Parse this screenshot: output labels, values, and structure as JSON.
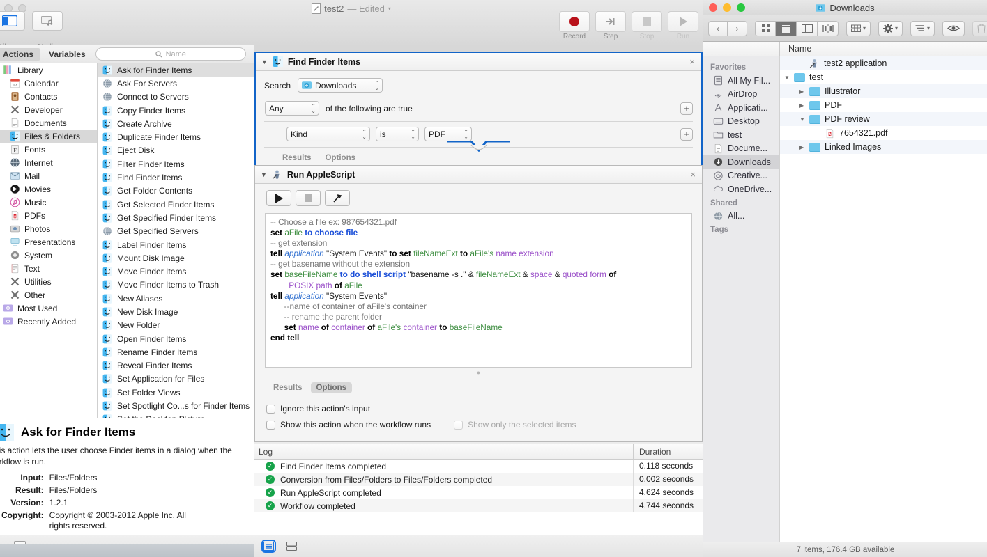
{
  "automator": {
    "document_title": "test2",
    "document_state": "— Edited",
    "toolbar_left": [
      {
        "label": "Library",
        "icon": "library-icon"
      },
      {
        "label": "Media",
        "icon": "media-icon"
      }
    ],
    "toolbar_right": [
      {
        "label": "Record",
        "icon": "record-icon"
      },
      {
        "label": "Step",
        "icon": "step-icon"
      },
      {
        "label": "Stop",
        "icon": "stop-icon"
      },
      {
        "label": "Run",
        "icon": "run-icon"
      }
    ],
    "library_bar": {
      "tab_actions": "Actions",
      "tab_variables": "Variables",
      "search_placeholder": "Name",
      "search_value": "",
      "search_icon": "search-icon"
    },
    "library_items": [
      {
        "label": "Library",
        "icon": "library-color-icon",
        "selected": false
      },
      {
        "label": "Calendar",
        "icon": "calendar-icon",
        "selected": false
      },
      {
        "label": "Contacts",
        "icon": "contacts-icon",
        "selected": false
      },
      {
        "label": "Developer",
        "icon": "developer-icon",
        "selected": false
      },
      {
        "label": "Documents",
        "icon": "documents-icon",
        "selected": false
      },
      {
        "label": "Files & Folders",
        "icon": "finder-icon",
        "selected": true
      },
      {
        "label": "Fonts",
        "icon": "fonts-icon",
        "selected": false
      },
      {
        "label": "Internet",
        "icon": "internet-icon",
        "selected": false
      },
      {
        "label": "Mail",
        "icon": "mail-icon",
        "selected": false
      },
      {
        "label": "Movies",
        "icon": "movies-icon",
        "selected": false
      },
      {
        "label": "Music",
        "icon": "music-icon",
        "selected": false
      },
      {
        "label": "PDFs",
        "icon": "pdf-icon",
        "selected": false
      },
      {
        "label": "Photos",
        "icon": "photos-icon",
        "selected": false
      },
      {
        "label": "Presentations",
        "icon": "presentations-icon",
        "selected": false
      },
      {
        "label": "System",
        "icon": "system-icon",
        "selected": false
      },
      {
        "label": "Text",
        "icon": "text-icon",
        "selected": false
      },
      {
        "label": "Utilities",
        "icon": "utilities-icon",
        "selected": false
      },
      {
        "label": "Other",
        "icon": "other-icon",
        "selected": false
      },
      {
        "label": "Most Used",
        "icon": "smart-group-icon",
        "selected": false
      },
      {
        "label": "Recently Added",
        "icon": "smart-group-icon",
        "selected": false
      }
    ],
    "actions": [
      {
        "label": "Ask for Finder Items",
        "icon": "finder-icon",
        "selected": true
      },
      {
        "label": "Ask For Servers",
        "icon": "globe-icon",
        "selected": false
      },
      {
        "label": "Connect to Servers",
        "icon": "globe-icon",
        "selected": false
      },
      {
        "label": "Copy Finder Items",
        "icon": "finder-icon",
        "selected": false
      },
      {
        "label": "Create Archive",
        "icon": "finder-icon",
        "selected": false
      },
      {
        "label": "Duplicate Finder Items",
        "icon": "finder-icon",
        "selected": false
      },
      {
        "label": "Eject Disk",
        "icon": "finder-icon",
        "selected": false
      },
      {
        "label": "Filter Finder Items",
        "icon": "finder-icon",
        "selected": false
      },
      {
        "label": "Find Finder Items",
        "icon": "finder-icon",
        "selected": false
      },
      {
        "label": "Get Folder Contents",
        "icon": "finder-icon",
        "selected": false
      },
      {
        "label": "Get Selected Finder Items",
        "icon": "finder-icon",
        "selected": false
      },
      {
        "label": "Get Specified Finder Items",
        "icon": "finder-icon",
        "selected": false
      },
      {
        "label": "Get Specified Servers",
        "icon": "globe-icon",
        "selected": false
      },
      {
        "label": "Label Finder Items",
        "icon": "finder-icon",
        "selected": false
      },
      {
        "label": "Mount Disk Image",
        "icon": "finder-icon",
        "selected": false
      },
      {
        "label": "Move Finder Items",
        "icon": "finder-icon",
        "selected": false
      },
      {
        "label": "Move Finder Items to Trash",
        "icon": "finder-icon",
        "selected": false
      },
      {
        "label": "New Aliases",
        "icon": "finder-icon",
        "selected": false
      },
      {
        "label": "New Disk Image",
        "icon": "finder-icon",
        "selected": false
      },
      {
        "label": "New Folder",
        "icon": "finder-icon",
        "selected": false
      },
      {
        "label": "Open Finder Items",
        "icon": "finder-icon",
        "selected": false
      },
      {
        "label": "Rename Finder Items",
        "icon": "finder-icon",
        "selected": false
      },
      {
        "label": "Reveal Finder Items",
        "icon": "finder-icon",
        "selected": false
      },
      {
        "label": "Set Application for Files",
        "icon": "finder-icon",
        "selected": false
      },
      {
        "label": "Set Folder Views",
        "icon": "finder-icon",
        "selected": false
      },
      {
        "label": "Set Spotlight Co...s for Finder Items",
        "icon": "finder-icon",
        "selected": false
      },
      {
        "label": "Set the Desktop Picture",
        "icon": "finder-icon",
        "selected": false
      }
    ],
    "description": {
      "title": "Ask for Finder Items",
      "icon": "finder-icon",
      "body": "his action lets the user choose Finder items in a dialog when the orkflow is run.",
      "fields": [
        {
          "label": "Input:",
          "value": "Files/Folders"
        },
        {
          "label": "Result:",
          "value": "Files/Folders"
        },
        {
          "label": "Version:",
          "value": "1.2.1"
        },
        {
          "label": "Copyright:",
          "value": "Copyright © 2003-2012 Apple Inc.  All rights reserved."
        }
      ]
    },
    "action_find": {
      "title": "Find Finder Items",
      "icon": "finder-icon",
      "close_icon": "close-icon",
      "disclosure_icon": "triangle-down-icon",
      "search_label": "Search",
      "search_value": "Downloads",
      "search_icon": "downloads-folder-icon",
      "match_value": "Any",
      "match_suffix": "of the following are true",
      "add_icon": "plus-icon",
      "criterion": {
        "attribute": "Kind",
        "operator": "is",
        "value": "PDF"
      },
      "tabs": [
        {
          "label": "Results",
          "selected": false
        },
        {
          "label": "Options",
          "selected": false
        }
      ]
    },
    "action_script": {
      "title": "Run AppleScript",
      "icon": "applescript-icon",
      "close_icon": "close-icon",
      "disclosure_icon": "triangle-down-icon",
      "buttons": [
        {
          "name": "run-script-button",
          "icon": "play-icon"
        },
        {
          "name": "stop-script-button",
          "icon": "stop-icon"
        },
        {
          "name": "compile-script-button",
          "icon": "hammer-icon"
        }
      ],
      "code_lines": [
        [
          {
            "t": "-- Choose a file ex: 987654321.pdf",
            "c": "cm"
          }
        ],
        [
          {
            "t": "set ",
            "c": "k"
          },
          {
            "t": "aFile ",
            "c": "va"
          },
          {
            "t": "to choose file",
            "c": "kb"
          }
        ],
        [
          {
            "t": "-- get extension",
            "c": "cm"
          }
        ],
        [
          {
            "t": "tell ",
            "c": "k"
          },
          {
            "t": "application ",
            "c": "ap"
          },
          {
            "t": "\"System Events\" ",
            "c": "st"
          },
          {
            "t": "to set ",
            "c": "k"
          },
          {
            "t": "fileNameExt ",
            "c": "va"
          },
          {
            "t": "to ",
            "c": "k"
          },
          {
            "t": "aFile's ",
            "c": "va"
          },
          {
            "t": "name extension",
            "c": "pr"
          }
        ],
        [
          {
            "t": "-- get basename without the extension",
            "c": "cm"
          }
        ],
        [
          {
            "t": "set ",
            "c": "k"
          },
          {
            "t": "baseFileName ",
            "c": "va"
          },
          {
            "t": "to do shell script ",
            "c": "kb"
          },
          {
            "t": "\"basename -s .\" ",
            "c": "st"
          },
          {
            "t": "& ",
            "c": "st"
          },
          {
            "t": "fileNameExt ",
            "c": "va"
          },
          {
            "t": "& ",
            "c": "st"
          },
          {
            "t": "space ",
            "c": "pr"
          },
          {
            "t": "& ",
            "c": "st"
          },
          {
            "t": "quoted form ",
            "c": "pr"
          },
          {
            "t": "of",
            "c": "k"
          }
        ],
        [
          {
            "t": "        POSIX path ",
            "c": "pr"
          },
          {
            "t": "of ",
            "c": "k"
          },
          {
            "t": "aFile",
            "c": "va"
          }
        ],
        [
          {
            "t": "tell ",
            "c": "k"
          },
          {
            "t": "application ",
            "c": "ap"
          },
          {
            "t": "\"System Events\"",
            "c": "st"
          }
        ],
        [
          {
            "t": "      --name of container of aFile's container",
            "c": "cm"
          }
        ],
        [
          {
            "t": "      -- rename the parent folder",
            "c": "cm"
          }
        ],
        [
          {
            "t": "      ",
            "c": "st"
          },
          {
            "t": "set ",
            "c": "k"
          },
          {
            "t": "name ",
            "c": "pr"
          },
          {
            "t": "of ",
            "c": "k"
          },
          {
            "t": "container ",
            "c": "pr"
          },
          {
            "t": "of ",
            "c": "k"
          },
          {
            "t": "aFile's ",
            "c": "va"
          },
          {
            "t": "container ",
            "c": "pr"
          },
          {
            "t": "to ",
            "c": "k"
          },
          {
            "t": "baseFileName",
            "c": "va"
          }
        ],
        [
          {
            "t": "end tell",
            "c": "k"
          }
        ]
      ],
      "tabs": [
        {
          "label": "Results",
          "selected": false
        },
        {
          "label": "Options",
          "selected": true
        }
      ],
      "options": [
        {
          "label": "Ignore this action's input",
          "checked": false,
          "dim": false
        },
        {
          "label": "Show this action when the workflow runs",
          "checked": false,
          "dim": false
        },
        {
          "label": "Show only the selected items",
          "checked": false,
          "dim": true
        }
      ]
    },
    "log": {
      "columns": [
        "Log",
        "Duration"
      ],
      "rows": [
        {
          "status": "ok",
          "message": "Find Finder Items completed",
          "duration": "0.118 seconds"
        },
        {
          "status": "ok",
          "message": "Conversion from Files/Folders to Files/Folders completed",
          "duration": "0.002 seconds"
        },
        {
          "status": "ok",
          "message": "Run AppleScript completed",
          "duration": "4.624 seconds"
        },
        {
          "status": "ok",
          "message": "Workflow completed",
          "duration": "4.744 seconds"
        }
      ],
      "view_buttons": [
        {
          "name": "log-list-view-button",
          "icon": "list-view-icon",
          "selected": true
        },
        {
          "name": "log-split-view-button",
          "icon": "split-view-icon",
          "selected": false
        }
      ]
    }
  },
  "finder": {
    "window_title": "Downloads",
    "title_icon": "downloads-folder-icon",
    "traffic_colors": [
      "#ff5f57",
      "#febc2e",
      "#28c840"
    ],
    "toolbar": {
      "back_icon": "chevron-left-icon",
      "forward_icon": "chevron-right-icon",
      "view_modes": [
        {
          "name": "icon-view-button",
          "icon": "grid-view-icon",
          "selected": false
        },
        {
          "name": "list-view-button",
          "icon": "list-view-icon",
          "selected": true
        },
        {
          "name": "column-view-button",
          "icon": "column-view-icon",
          "selected": false
        },
        {
          "name": "coverflow-view-button",
          "icon": "coverflow-view-icon",
          "selected": false
        }
      ],
      "arrange_icon": "arrange-icon",
      "action_icon": "gear-icon",
      "share_icon": "share-list-icon",
      "quicklook_icon": "eye-icon",
      "delete_icon": "trash-icon"
    },
    "column_header": "Name",
    "sidebar": [
      {
        "group": "Favorites",
        "items": [
          {
            "label": "All My Fil...",
            "icon": "all-my-files-icon",
            "selected": false
          },
          {
            "label": "AirDrop",
            "icon": "airdrop-icon",
            "selected": false
          },
          {
            "label": "Applicati...",
            "icon": "applications-icon",
            "selected": false
          },
          {
            "label": "Desktop",
            "icon": "desktop-icon",
            "selected": false
          },
          {
            "label": "test",
            "icon": "folder-icon",
            "selected": false
          },
          {
            "label": "Docume...",
            "icon": "documents-icon",
            "selected": false
          },
          {
            "label": "Downloads",
            "icon": "downloads-icon",
            "selected": true
          },
          {
            "label": "Creative...",
            "icon": "creative-cloud-icon",
            "selected": false
          },
          {
            "label": "OneDrive...",
            "icon": "onedrive-icon",
            "selected": false
          }
        ]
      },
      {
        "group": "Shared",
        "items": [
          {
            "label": "All...",
            "icon": "network-icon",
            "selected": false
          }
        ]
      },
      {
        "group": "Tags",
        "items": []
      }
    ],
    "files": [
      {
        "name": "test2 application",
        "icon": "applescript-icon",
        "indent": 1,
        "twisty": "none"
      },
      {
        "name": "test",
        "icon": "folder-icon",
        "indent": 0,
        "twisty": "down"
      },
      {
        "name": "Illustrator",
        "icon": "folder-icon",
        "indent": 1,
        "twisty": "right"
      },
      {
        "name": "PDF",
        "icon": "folder-icon",
        "indent": 1,
        "twisty": "right"
      },
      {
        "name": "PDF review",
        "icon": "folder-icon",
        "indent": 1,
        "twisty": "down"
      },
      {
        "name": "7654321.pdf",
        "icon": "pdf-file-icon",
        "indent": 2,
        "twisty": "none"
      },
      {
        "name": "Linked Images",
        "icon": "folder-icon",
        "indent": 1,
        "twisty": "right"
      }
    ],
    "status": "7 items, 176.4 GB available"
  }
}
